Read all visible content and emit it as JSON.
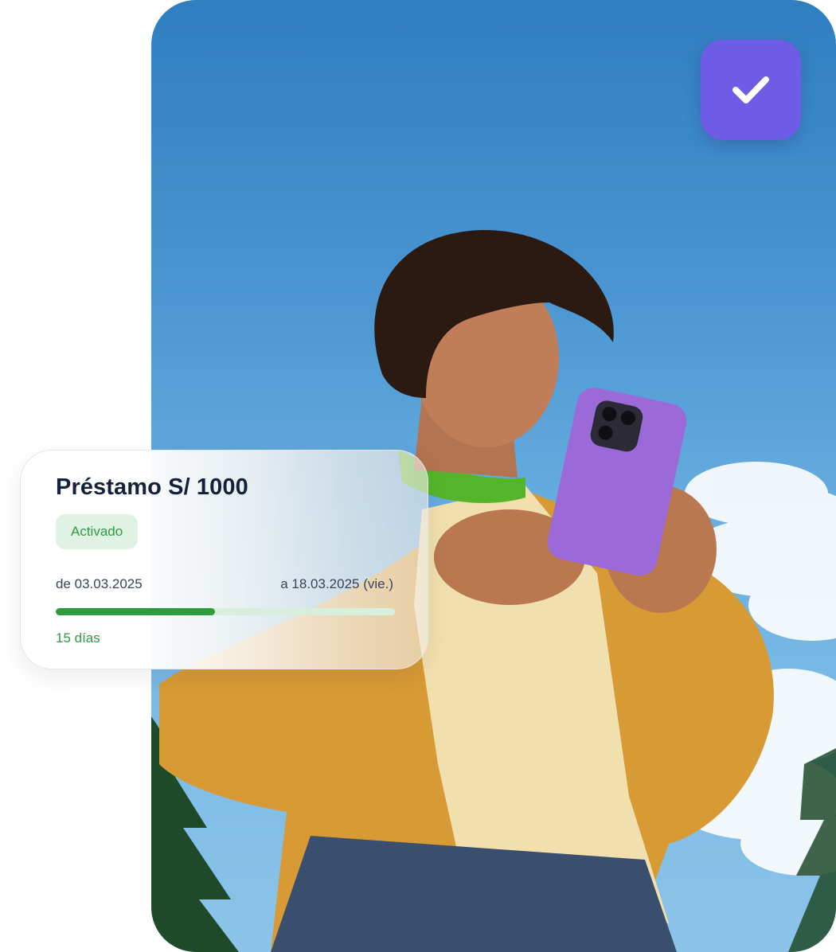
{
  "loan": {
    "title": "Préstamo S/ 1000",
    "status": "Activado",
    "from_label": "de 03.03.2025",
    "to_label": "a 18.03.2025 (vie.)",
    "progress_fraction": 0.47,
    "days_label": "15 días"
  },
  "colors": {
    "accent": "#6f5ce6",
    "success": "#2f9b3e",
    "success_bg": "#e0f2e4",
    "title": "#13213c"
  },
  "icons": {
    "check_badge": "check-icon"
  }
}
